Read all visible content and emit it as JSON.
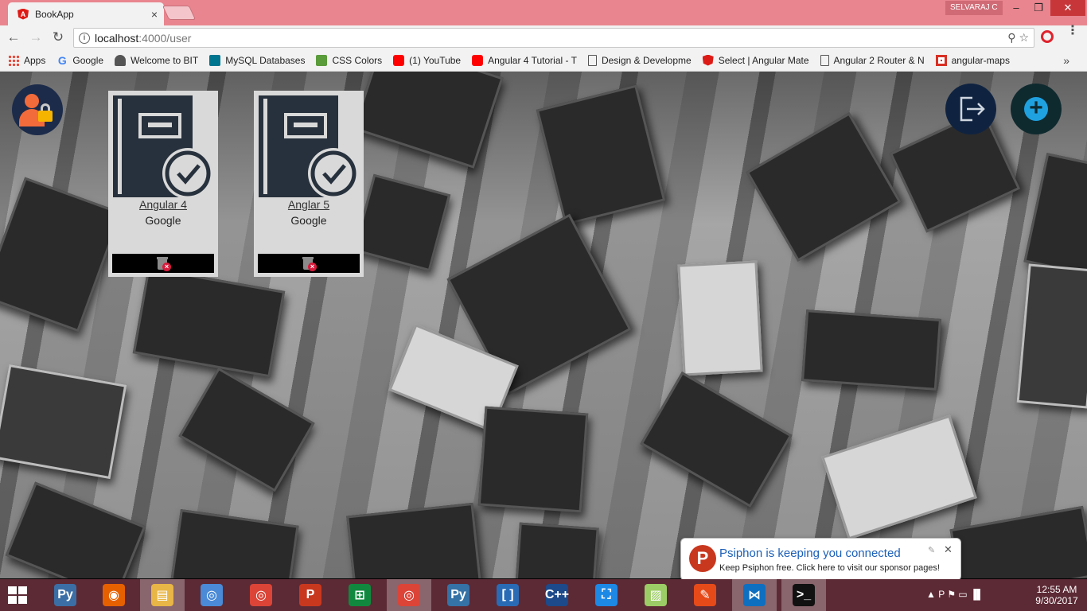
{
  "browser": {
    "tab_title": "BookApp",
    "tab_close": "×",
    "profile_name": "SELVARAJ C",
    "win_minimize": "–",
    "win_maximize": "❐",
    "win_close": "✕",
    "url_host": "localhost",
    "url_path": ":4000/user",
    "back_glyph": "←",
    "forward_glyph": "→",
    "reload_glyph": "↻",
    "info_glyph": "i",
    "omni_icons": "⚲  ☆",
    "menu_glyph": "⋮",
    "bookmarks_more": "»",
    "bookmarks": [
      {
        "label": "Apps",
        "icon": "apps-grid-icon"
      },
      {
        "label": "Google",
        "icon": "google-icon"
      },
      {
        "label": "Welcome to BIT",
        "icon": "bit-icon"
      },
      {
        "label": "MySQL Databases",
        "icon": "mysql-icon"
      },
      {
        "label": "CSS Colors",
        "icon": "css-colors-icon"
      },
      {
        "label": "(1) YouTube",
        "icon": "youtube-icon"
      },
      {
        "label": "Angular 4 Tutorial - T",
        "icon": "youtube-icon"
      },
      {
        "label": "Design & Developme",
        "icon": "document-icon"
      },
      {
        "label": "Select | Angular Mate",
        "icon": "angular-icon"
      },
      {
        "label": "Angular 2 Router & N",
        "icon": "document-icon"
      },
      {
        "label": "angular-maps",
        "icon": "maps-icon"
      }
    ]
  },
  "page": {
    "books": [
      {
        "title": "Angular 4",
        "author": "Google"
      },
      {
        "title": "Anglar 5",
        "author": "Google"
      }
    ]
  },
  "notification": {
    "title": "Psiphon is keeping you connected",
    "body": "Keep Psiphon free. Click here to visit our sponsor pages!",
    "logo": "P",
    "close": "✕",
    "settings": "✎"
  },
  "taskbar": {
    "apps": [
      {
        "name": "python-installer",
        "glyph": "Py",
        "color": "#3b6ea5",
        "active": false
      },
      {
        "name": "firefox",
        "glyph": "◉",
        "color": "#e66000",
        "active": false
      },
      {
        "name": "file-explorer",
        "glyph": "▤",
        "color": "#e8b646",
        "active": true
      },
      {
        "name": "chromium",
        "glyph": "◎",
        "color": "#4a8ad6",
        "active": false
      },
      {
        "name": "chrome",
        "glyph": "◎",
        "color": "#db4437",
        "active": false
      },
      {
        "name": "psiphon",
        "glyph": "P",
        "color": "#c8381f",
        "active": false
      },
      {
        "name": "store",
        "glyph": "⊞",
        "color": "#10893e",
        "active": false
      },
      {
        "name": "chrome-profile",
        "glyph": "◎",
        "color": "#db4437",
        "active": true
      },
      {
        "name": "python",
        "glyph": "Py",
        "color": "#3572a5",
        "active": false
      },
      {
        "name": "brackets",
        "glyph": "[ ]",
        "color": "#2a6bb5",
        "active": false
      },
      {
        "name": "devcpp",
        "glyph": "C++",
        "color": "#1c4a8a",
        "active": false
      },
      {
        "name": "screen-capture",
        "glyph": "⛶",
        "color": "#1e88e5",
        "active": false
      },
      {
        "name": "photos",
        "glyph": "▨",
        "color": "#9ccc65",
        "active": false
      },
      {
        "name": "tools",
        "glyph": "✎",
        "color": "#e64a19",
        "active": false
      },
      {
        "name": "vscode",
        "glyph": "⋈",
        "color": "#0e6fc0",
        "active": true
      },
      {
        "name": "terminal",
        "glyph": ">_",
        "color": "#111111",
        "active": true
      }
    ],
    "tray_icons": "▲  P  ⚑  ▭  ▐▌",
    "time": "12:55 AM",
    "date": "9/30/2017"
  }
}
